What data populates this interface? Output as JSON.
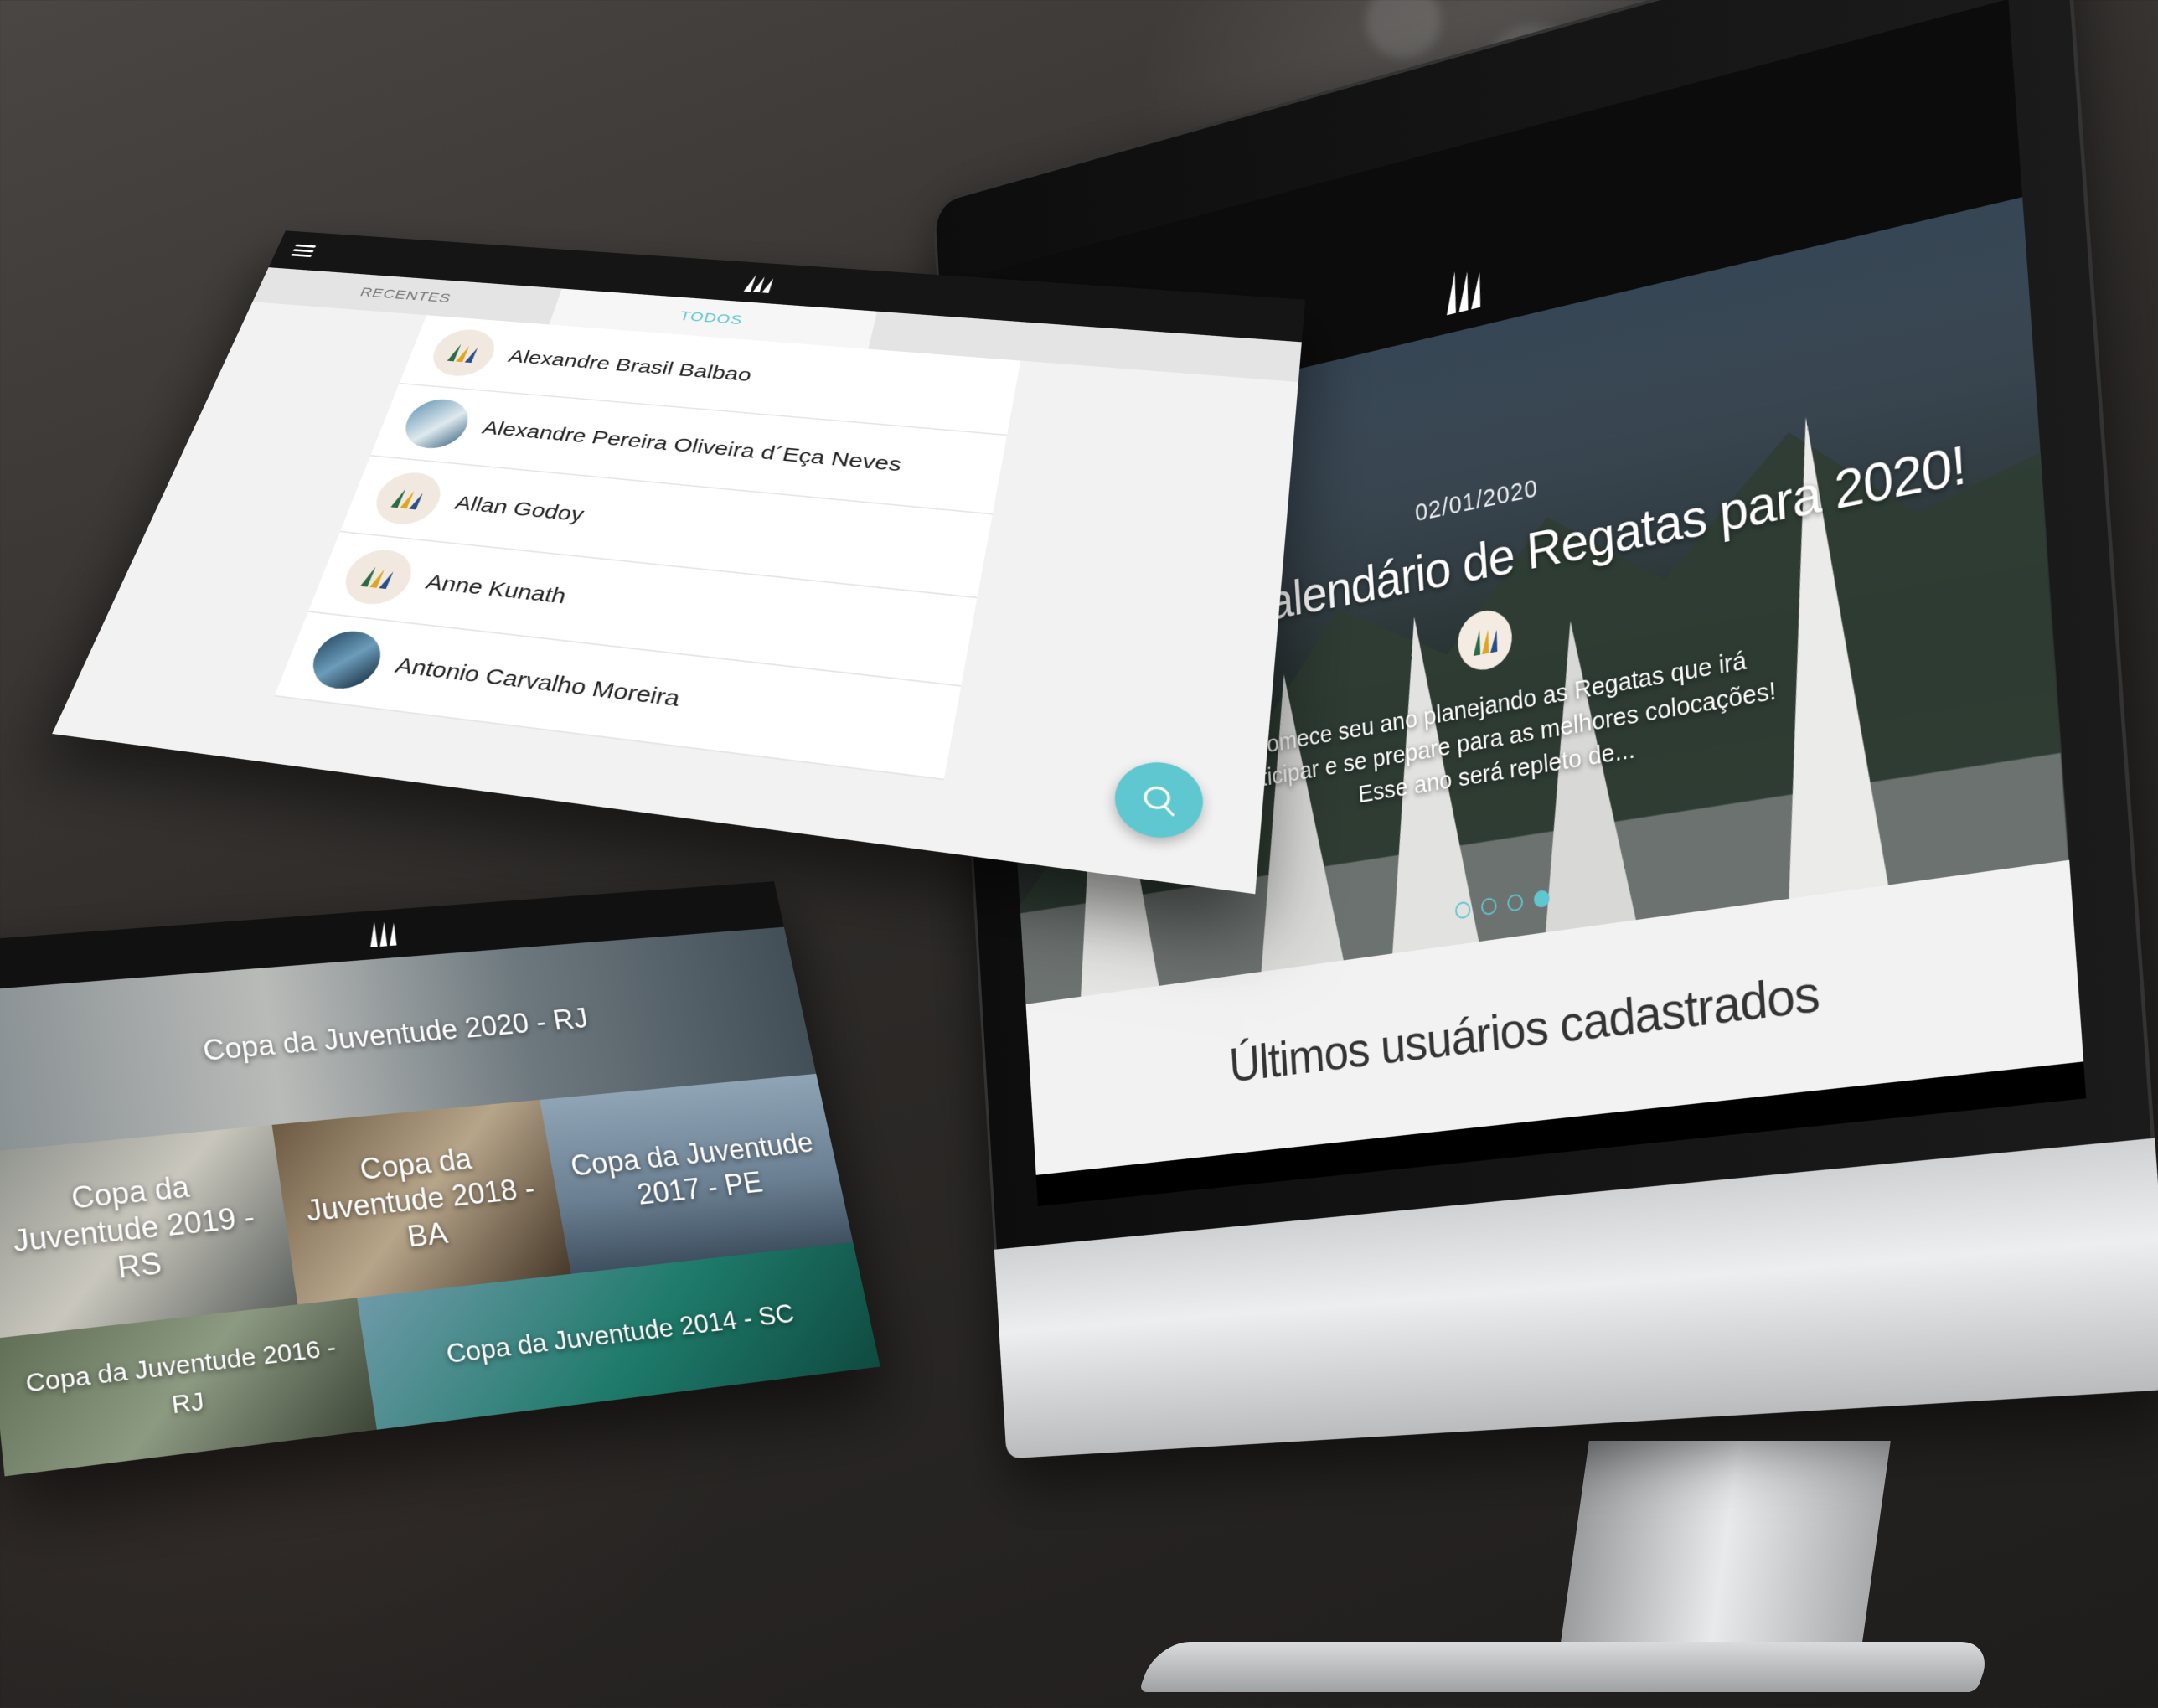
{
  "users_app": {
    "tabs": [
      {
        "label": "RECENTES",
        "active": false
      },
      {
        "label": "TODOS",
        "active": true
      }
    ],
    "users": [
      {
        "name": "Alexandre Brasil Balbao",
        "avatar": "logo"
      },
      {
        "name": "Alexandre Pereira Oliveira d´Eça Neves",
        "avatar": "photo"
      },
      {
        "name": "Allan Godoy",
        "avatar": "logo"
      },
      {
        "name": "Anne Kunath",
        "avatar": "logo"
      },
      {
        "name": "Antonio Carvalho Moreira",
        "avatar": "photo"
      }
    ],
    "search_icon": "search-icon",
    "accent": "#5ec7cf"
  },
  "events_app": {
    "close_icon": "close-icon",
    "events": [
      {
        "title": "Copa da Juventude 2020 - RJ"
      },
      {
        "title": "Copa da Juventude 2019 - RS"
      },
      {
        "title": "Copa da Juventude 2018 - BA"
      },
      {
        "title": "Copa da Juventude 2017 - PE"
      },
      {
        "title": "Copa da Juventude 2016 - RJ"
      },
      {
        "title": "Copa da Juventude 2014 - SC"
      }
    ]
  },
  "desktop_app": {
    "hero": {
      "date": "02/01/2020",
      "title": "Confira o Calendário de Regatas para 2020!",
      "description": "Comece seu ano planejando as Regatas que irá participar e se prepare para as melhores colocações! Esse ano será repleto de...",
      "slides_total": 4,
      "slide_active": 4
    },
    "users_section_title": "Últimos usuários cadastrados"
  }
}
